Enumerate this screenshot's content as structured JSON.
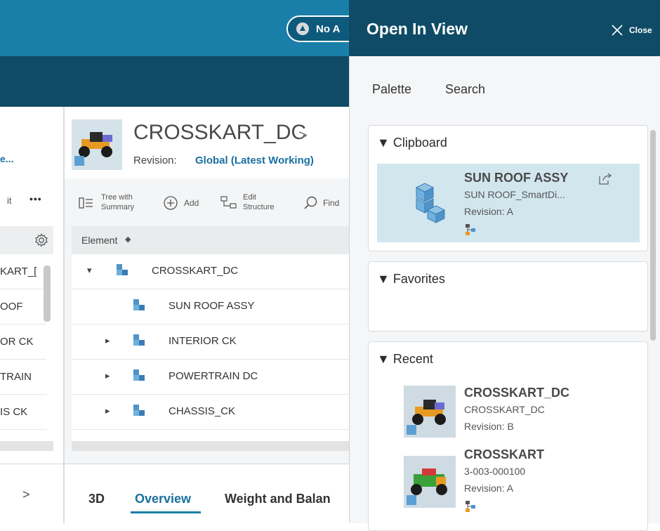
{
  "top": {
    "status_button_label": "No A"
  },
  "left": {
    "link_text": "e...",
    "toolbar_text": "it",
    "more_label": "•••",
    "rows": [
      "KART_[",
      "OOF",
      "OR CK",
      "TRAIN",
      "IS CK"
    ],
    "next_label": ">"
  },
  "center": {
    "title": "CROSSKART_DC",
    "title_chevron": ">",
    "revision_label": "Revision:",
    "revision_value": "Global (Latest Working)",
    "toolbar": {
      "tree_label_1": "Tree with",
      "tree_label_2": "Summary",
      "add_label": "Add",
      "edit_label_1": "Edit",
      "edit_label_2": "Structure",
      "find_label": "Find"
    },
    "table_header": "Element",
    "rows": [
      {
        "name": "CROSSKART_DC",
        "expander": "▾"
      },
      {
        "name": "SUN ROOF ASSY",
        "expander": ""
      },
      {
        "name": "INTERIOR CK",
        "expander": "▸"
      },
      {
        "name": "POWERTRAIN DC",
        "expander": "▸"
      },
      {
        "name": "CHASSIS_CK",
        "expander": "▸"
      }
    ],
    "tabs": [
      "3D",
      "Overview",
      "Weight and Balan"
    ],
    "active_tab": "Overview"
  },
  "panel": {
    "title": "Open In View",
    "close_label": "Close",
    "tabs": [
      "Palette",
      "Search"
    ],
    "clipboard": {
      "heading": "Clipboard",
      "item": {
        "name": "SUN ROOF ASSY",
        "id": "SUN ROOF_SmartDi...",
        "revision_label": "Revision:",
        "revision_value": "A"
      }
    },
    "favorites": {
      "heading": "Favorites"
    },
    "recent": {
      "heading": "Recent",
      "items": [
        {
          "name": "CROSSKART_DC",
          "id": "CROSSKART_DC",
          "revision_label": "Revision:",
          "revision_value": "B"
        },
        {
          "name": "CROSSKART",
          "id": "3-003-000100",
          "revision_label": "Revision:",
          "revision_value": "A"
        }
      ]
    }
  },
  "colors": {
    "header_blue": "#1a7fa8",
    "navy": "#0f4b66",
    "selected_bg": "#d2e6ee",
    "accent": "#1a6fa0"
  },
  "icons": [
    "search-icon",
    "settings-icon",
    "close-icon",
    "share-icon",
    "cube-icon",
    "structure-icon",
    "add-icon",
    "tree-icon"
  ]
}
